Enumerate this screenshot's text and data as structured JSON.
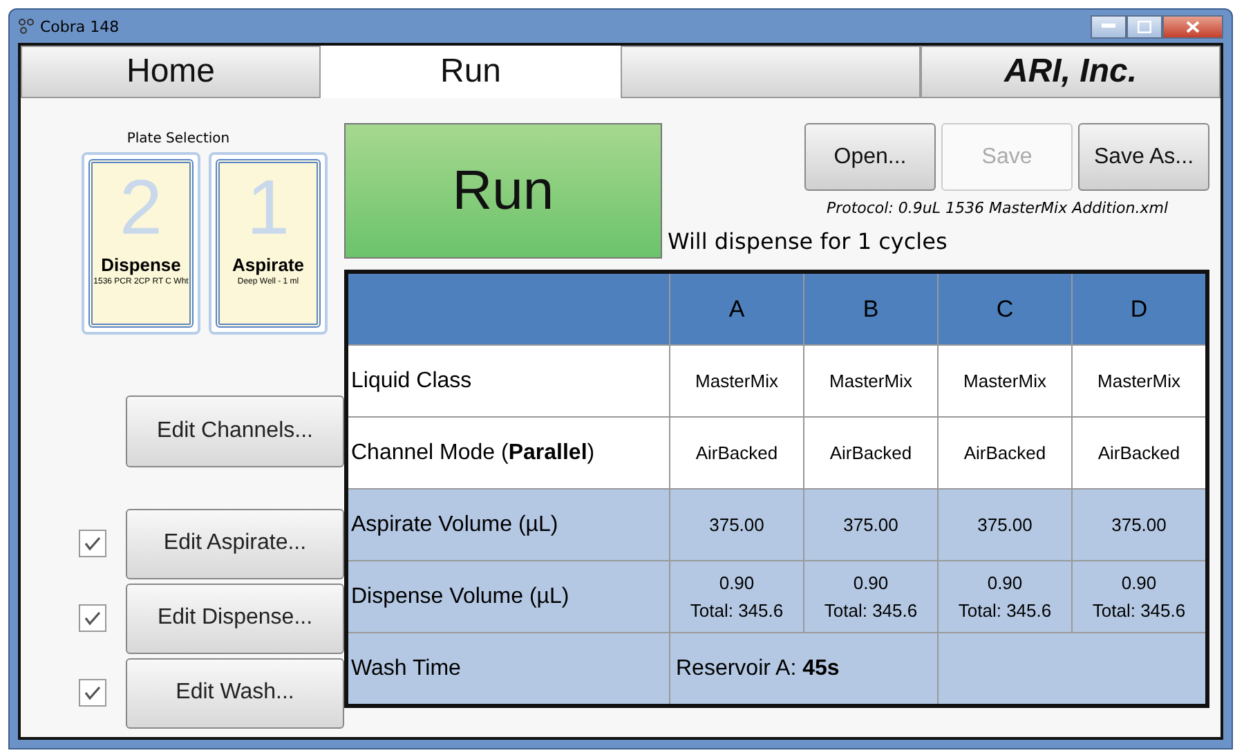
{
  "window": {
    "title": "Cobra 148"
  },
  "tabs": [
    {
      "label": "Home",
      "selected": false
    },
    {
      "label": "Run",
      "selected": true
    }
  ],
  "brand": "ARI, Inc.",
  "plate_selection": {
    "title": "Plate Selection",
    "plates": [
      {
        "number": "2",
        "label": "Dispense",
        "detail": "1536 PCR 2CP RT C Wht",
        "selected": false
      },
      {
        "number": "1",
        "label": "Aspirate",
        "detail": "Deep Well - 1 ml",
        "selected": false
      }
    ]
  },
  "run_button": "Run",
  "file_buttons": [
    {
      "label": "Open...",
      "disabled": false
    },
    {
      "label": "Save",
      "disabled": true
    },
    {
      "label": "Save As...",
      "disabled": false
    }
  ],
  "protocol": "Protocol:  0.9uL 1536 MasterMix Addition.xml",
  "cycles_text": "Will dispense for 1 cycles",
  "step_buttons": [
    {
      "label": "Edit Channels...",
      "kind": "plain"
    },
    {
      "label": "Edit Aspirate...",
      "kind": "check",
      "checked": true
    },
    {
      "label": "Edit Dispense...",
      "kind": "check",
      "checked": true
    },
    {
      "label": "Edit Wash...",
      "kind": "check",
      "checked": true
    }
  ],
  "table": {
    "columns": [
      "A",
      "B",
      "C",
      "D"
    ],
    "rows": [
      {
        "label": "Liquid Class",
        "shaded": false,
        "kind": "cells",
        "cells": [
          [
            "MasterMix"
          ],
          [
            "MasterMix"
          ],
          [
            "MasterMix"
          ],
          [
            "MasterMix"
          ]
        ]
      },
      {
        "label": "Channel Mode (**Parallel**)",
        "shaded": false,
        "kind": "cells",
        "cells": [
          [
            "AirBacked"
          ],
          [
            "AirBacked"
          ],
          [
            "AirBacked"
          ],
          [
            "AirBacked"
          ]
        ]
      },
      {
        "label": "Aspirate Volume (µL)",
        "shaded": true,
        "kind": "cells",
        "cells": [
          [
            "375.00"
          ],
          [
            "375.00"
          ],
          [
            "375.00"
          ],
          [
            "375.00"
          ]
        ]
      },
      {
        "label": "Dispense Volume (µL)",
        "shaded": true,
        "kind": "cells",
        "cells": [
          [
            "0.90",
            "Total: 345.6"
          ],
          [
            "0.90",
            "Total: 345.6"
          ],
          [
            "0.90",
            "Total: 345.6"
          ],
          [
            "0.90",
            "Total: 345.6"
          ]
        ]
      },
      {
        "label": "Wash Time",
        "shaded": true,
        "kind": "merged",
        "value": "Reservoir A: **45s**"
      }
    ]
  }
}
